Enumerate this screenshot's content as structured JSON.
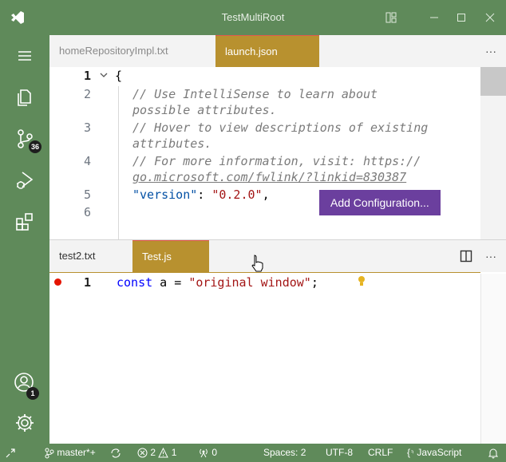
{
  "window": {
    "title": "TestMultiRoot"
  },
  "activity_bar": {
    "items": [
      {
        "icon": "menu-icon"
      },
      {
        "icon": "explorer-icon"
      },
      {
        "icon": "source-control-icon",
        "badge": "36"
      },
      {
        "icon": "run-debug-icon"
      },
      {
        "icon": "extensions-icon"
      }
    ],
    "accounts_badge": "1"
  },
  "top_group": {
    "tabs": [
      {
        "label": "homeRepositoryImpl.txt",
        "active": false
      },
      {
        "label": "launch.json",
        "active": true
      }
    ],
    "more_label": "···",
    "lines": [
      {
        "num": "1",
        "text": "{"
      },
      {
        "num": "2",
        "text": "// Use IntelliSense to learn about",
        "cont": "possible attributes."
      },
      {
        "num": "3",
        "text": "// Hover to view descriptions of existing",
        "cont": "attributes."
      },
      {
        "num": "4",
        "text": "// For more information, visit: https://",
        "cont": "go.microsoft.com/fwlink/?linkid=830387"
      },
      {
        "num": "5",
        "key": "\"version\"",
        "sep": ": ",
        "value": "\"0.2.0\"",
        "end": ","
      },
      {
        "num": "6",
        "text": ""
      }
    ],
    "add_configuration": "Add Configuration..."
  },
  "bottom_group": {
    "tabs": [
      {
        "label": "test2.txt",
        "active": false
      },
      {
        "label": "Test.js",
        "active": true
      }
    ],
    "more_label": "···",
    "line": {
      "num": "1",
      "kw": "const",
      "ident": " a = ",
      "str": "\"original window\"",
      "end": ";"
    }
  },
  "status_bar": {
    "branch": "master*+",
    "errors": "2",
    "warnings": "1",
    "ports": "0",
    "spaces": "Spaces: 2",
    "encoding": "UTF-8",
    "eol": "CRLF",
    "language": "JavaScript"
  },
  "colors": {
    "chrome": "#5f8a5a",
    "active_tab": "#b8912f",
    "hover_button": "#6b3f9e"
  }
}
